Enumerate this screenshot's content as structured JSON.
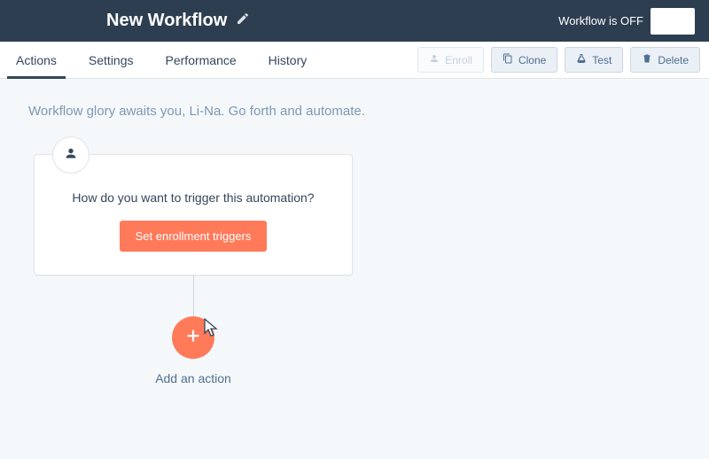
{
  "header": {
    "title": "New Workflow",
    "status_text": "Workflow is OFF"
  },
  "tabs": {
    "actions": "Actions",
    "settings": "Settings",
    "performance": "Performance",
    "history": "History"
  },
  "buttons": {
    "enroll": "Enroll",
    "clone": "Clone",
    "test": "Test",
    "delete": "Delete"
  },
  "canvas": {
    "welcome": "Workflow glory awaits you, Li-Na. Go forth and automate.",
    "trigger_question": "How do you want to trigger this automation?",
    "set_triggers_label": "Set enrollment triggers",
    "add_action_label": "Add an action"
  }
}
